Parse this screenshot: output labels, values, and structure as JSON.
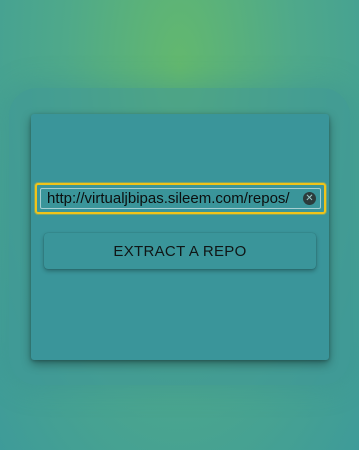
{
  "form": {
    "url_value": "http://virtualjbipas.sileem.com/repos/",
    "clear_icon": "clear-icon",
    "extract_label": "EXTRACT A REPO"
  },
  "colors": {
    "background_top": "#63b86e",
    "background_bottom": "#3e9b99",
    "card": "#3a959a",
    "focus_outline": "#f0c419"
  }
}
